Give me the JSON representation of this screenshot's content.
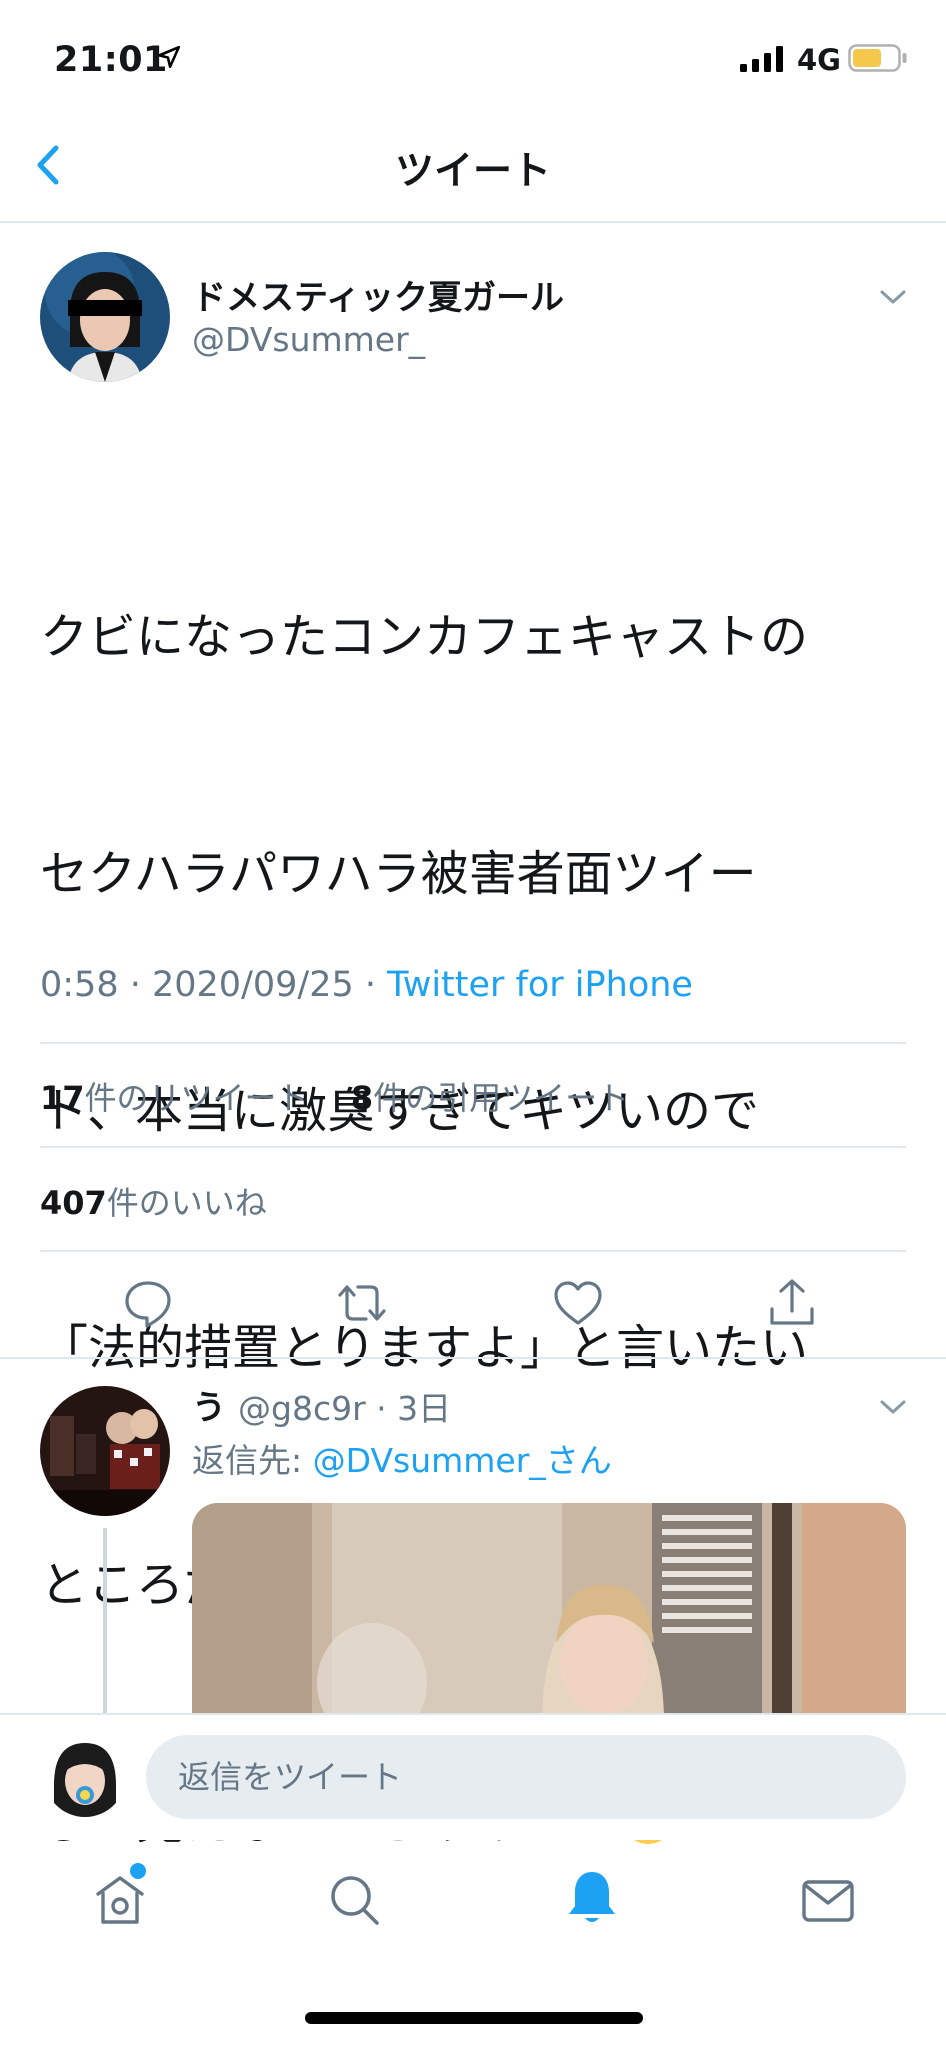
{
  "status_bar": {
    "time": "21:01",
    "network": "4G",
    "icons": [
      "location-arrow-icon",
      "signal-icon",
      "battery-icon"
    ]
  },
  "nav": {
    "title": "ツイート",
    "back_icon": "chevron-left-icon"
  },
  "tweet": {
    "display_name": "ドメスティック夏ガール",
    "handle": "@DVsummer_",
    "body_lines": [
      "クビになったコンカフェキャストの",
      "セクハラパワハラ被害者面ツイー",
      "ト、本当に激臭すぎてキツいので",
      "「法的措置とりますよ」と言いたい",
      "ところだが、側から見たらへ/なぎに",
      "しか見えないからやめとこ"
    ],
    "body_emoji": "pleading-face-emoji",
    "time": "0:58",
    "sep1": " · ",
    "date": "2020/09/25",
    "sep2": " · ",
    "source": "Twitter for iPhone",
    "retweets_count": "17",
    "retweets_label": "件のリツイート",
    "quotes_count": "8",
    "quotes_label": "件の引用ツイート",
    "likes_count": "407",
    "likes_label": "件のいいね"
  },
  "actions": [
    "reply-icon",
    "retweet-icon",
    "like-icon",
    "share-icon"
  ],
  "reply": {
    "display_name": "う",
    "handle": "@g8c9r",
    "sep": " · ",
    "age": "3日",
    "reply_to_prefix": "返信先: ",
    "reply_to_mention": "@DVsummer_さん"
  },
  "compose": {
    "placeholder": "返信をツイート"
  },
  "tab_bar": {
    "items": [
      "home-icon",
      "search-icon",
      "notifications-bell-icon",
      "messages-envelope-icon"
    ]
  },
  "colors": {
    "accent": "#1da1f2",
    "text": "#14171a",
    "secondary": "#657786",
    "divider": "#e1e8ed",
    "input_bg": "#e6ecf0",
    "battery": "#f5c84c"
  }
}
